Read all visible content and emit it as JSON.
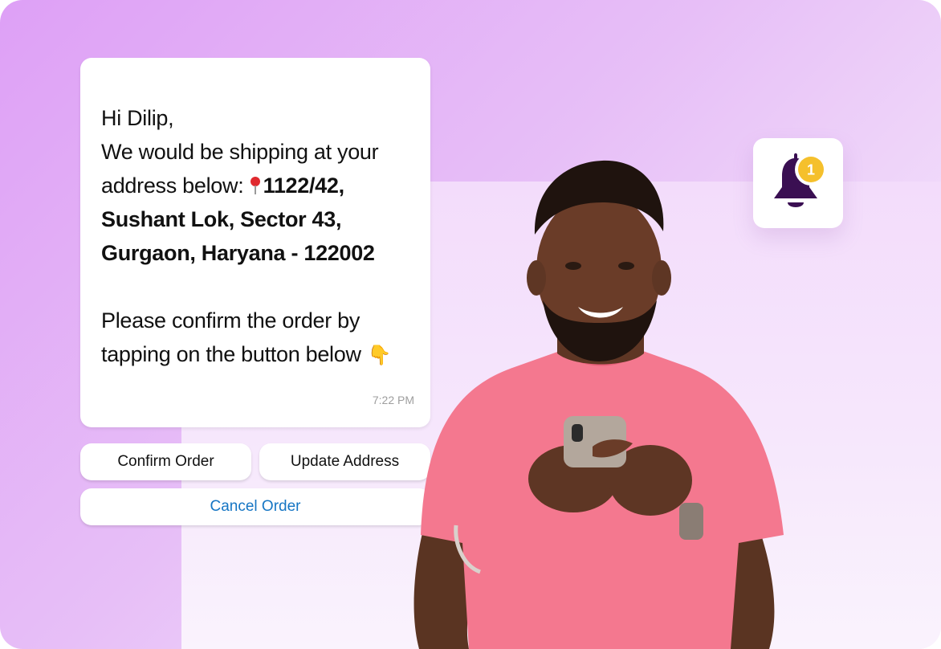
{
  "message": {
    "greeting": "Hi Dilip,",
    "line1": "We would be shipping at your",
    "line2_prefix": "address below: ",
    "address_line1": "1122/42,",
    "address_line2": "Sushant Lok, Sector 43,",
    "address_line3": "Gurgaon, Haryana - 122002",
    "confirm_line1": "Please confirm the order by",
    "confirm_line2": "tapping on the button below",
    "time": "7:22 PM"
  },
  "buttons": {
    "confirm": "Confirm Order",
    "update": "Update Address",
    "cancel": "Cancel Order"
  },
  "notification": {
    "count": "1",
    "icon": "bell-icon"
  },
  "colors": {
    "cancel_text": "#1676c4",
    "bell": "#3a0f52",
    "badge": "#f5c02c",
    "shirt": "#f4788f"
  }
}
